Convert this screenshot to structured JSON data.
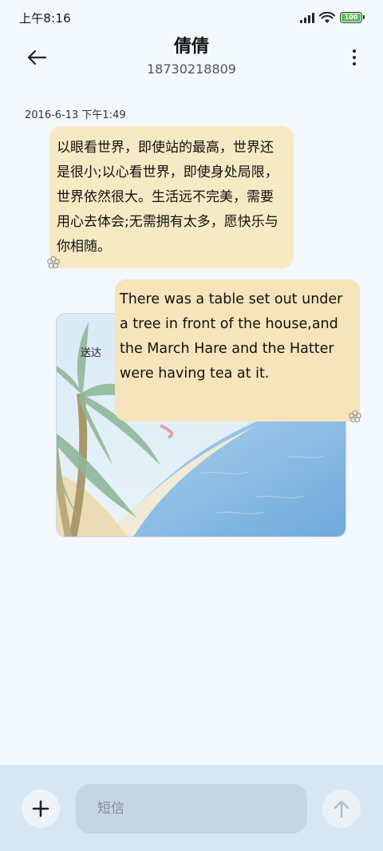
{
  "status_bar": {
    "time": "上午8:16",
    "battery_level": "100",
    "battery_color": "#59c25a",
    "icons": [
      "signal-icon",
      "wifi-icon",
      "battery-icon"
    ]
  },
  "header": {
    "contact_name": "倩倩",
    "contact_number": "18730218809",
    "back_icon": "back-arrow-icon",
    "more_icon": "more-vertical-icon"
  },
  "conversation": {
    "timestamp": "2016-6-13 下午1:49",
    "messages": [
      {
        "direction": "incoming",
        "text": "以眼看世界，即使站的最高，世界还是很小;以心看世界，即使身处局限，世界依然很大。生活远不完美，需要用心去体会;无需拥有太多，愿快乐与你相随。",
        "bubble_color": "#f6eac4"
      },
      {
        "direction": "outgoing",
        "text": "There was a table set out under a tree in front of the house,and the March Hare and the Hatter were having tea at it.",
        "bubble_color": "#f6e4ba",
        "status": "送达"
      }
    ]
  },
  "input_bar": {
    "placeholder": "短信",
    "add_icon": "plus-icon",
    "send_icon": "send-arrow-icon"
  }
}
